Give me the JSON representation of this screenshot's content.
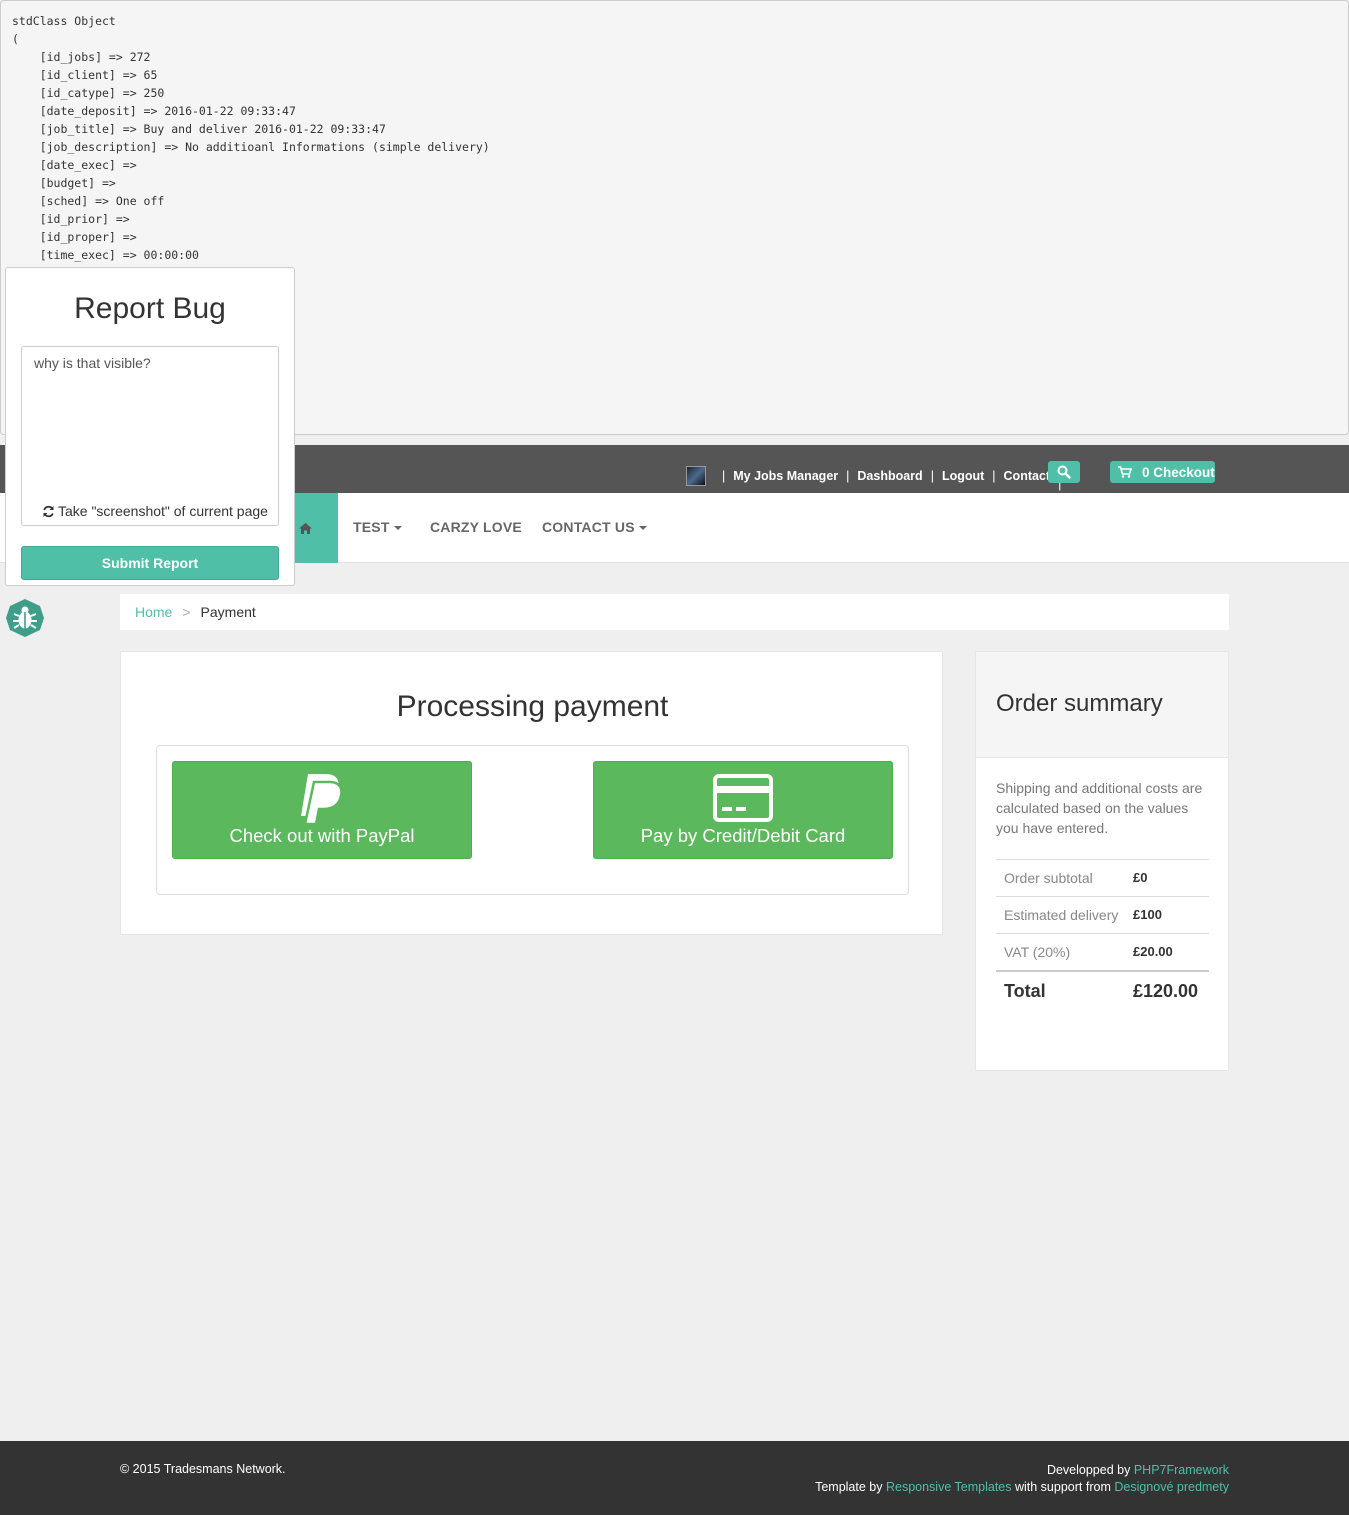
{
  "debug": {
    "lines": [
      "stdClass Object",
      "(",
      "    [id_jobs] => 272",
      "    [id_client] => 65",
      "    [id_catype] => 250",
      "    [date_deposit] => 2016-01-22 09:33:47",
      "    [job_title] => Buy and deliver 2016-01-22 09:33:47",
      "    [job_description] => No additioanl Informations (simple delivery)",
      "    [date_exec] =>",
      "    [budget] =>",
      "    [sched] => One off",
      "    [id_prior] =>",
      "    [id_proper] =>",
      "    [time_exec] => 00:00:00"
    ]
  },
  "topnav": {
    "links": [
      "My Jobs Manager",
      "Dashboard",
      "Logout",
      "Contact"
    ],
    "separator": "|",
    "checkout_label": "0 Checkout",
    "accent": "#4fbfa8"
  },
  "mainnav": {
    "home_icon": "home-icon",
    "items": [
      {
        "label": "TEST",
        "dropdown": true
      },
      {
        "label": "CARZY LOVE",
        "dropdown": false
      },
      {
        "label": "CONTACT US",
        "dropdown": true
      }
    ]
  },
  "breadcrumb": {
    "home": "Home",
    "separator": ">",
    "current": "Payment"
  },
  "payment": {
    "title": "Processing payment",
    "paypal_label": "Check out with PayPal",
    "card_label": "Pay by Credit/Debit Card",
    "button_color": "#5cb85c"
  },
  "summary": {
    "title": "Order summary",
    "note": "Shipping and additional costs are calculated based on the values you have entered.",
    "rows": [
      {
        "label": "Order subtotal",
        "value": "£0"
      },
      {
        "label": "Estimated delivery",
        "value": "£100"
      },
      {
        "label": "VAT (20%)",
        "value": "£20.00"
      }
    ],
    "total_label": "Total",
    "total_value": "£120.00"
  },
  "report_bug": {
    "title": "Report Bug",
    "textarea_value": "why is that visible?",
    "screenshot_label": "Take \"screenshot\" of current page",
    "submit_label": "Submit Report"
  },
  "footer": {
    "copyright": "© 2015 Tradesmans Network.",
    "developed_prefix": "Developped by",
    "developed_link": "PHP7Framework",
    "template_prefix": "Template by",
    "template_link": "Responsive Templates",
    "support_prefix": "with support from",
    "support_link": "Designové predmety"
  }
}
